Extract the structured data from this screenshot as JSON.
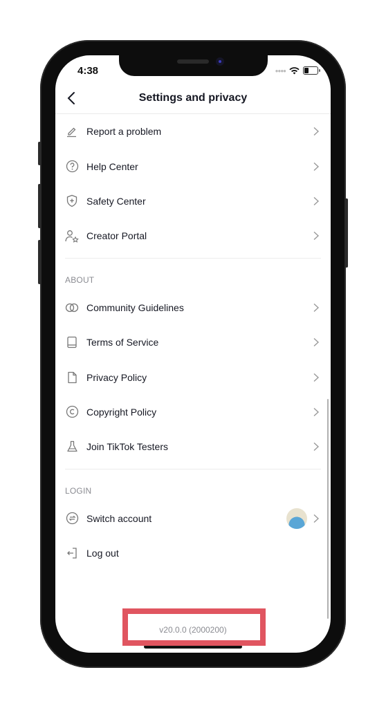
{
  "status_bar": {
    "time": "4:38",
    "battery_percent": 35
  },
  "header": {
    "title": "Settings and privacy",
    "back_icon": "chevron-left-icon"
  },
  "support_items": [
    {
      "label": "Report a problem",
      "icon": "pencil-icon"
    },
    {
      "label": "Help Center",
      "icon": "question-circle-icon"
    },
    {
      "label": "Safety Center",
      "icon": "shield-plus-icon"
    },
    {
      "label": "Creator Portal",
      "icon": "person-star-icon"
    }
  ],
  "about": {
    "heading": "ABOUT",
    "items": [
      {
        "label": "Community Guidelines",
        "icon": "interlocked-circles-icon"
      },
      {
        "label": "Terms of Service",
        "icon": "book-icon"
      },
      {
        "label": "Privacy Policy",
        "icon": "document-icon"
      },
      {
        "label": "Copyright Policy",
        "icon": "copyright-icon"
      },
      {
        "label": "Join TikTok Testers",
        "icon": "flask-icon"
      }
    ]
  },
  "login": {
    "heading": "LOGIN",
    "items": [
      {
        "label": "Switch account",
        "icon": "switch-arrows-icon",
        "has_avatar": true
      },
      {
        "label": "Log out",
        "icon": "logout-icon"
      }
    ]
  },
  "footer": {
    "version": "v20.0.0 (2000200)"
  },
  "colors": {
    "highlight": "#e05560",
    "text": "#161823",
    "muted": "#8a8b91"
  }
}
